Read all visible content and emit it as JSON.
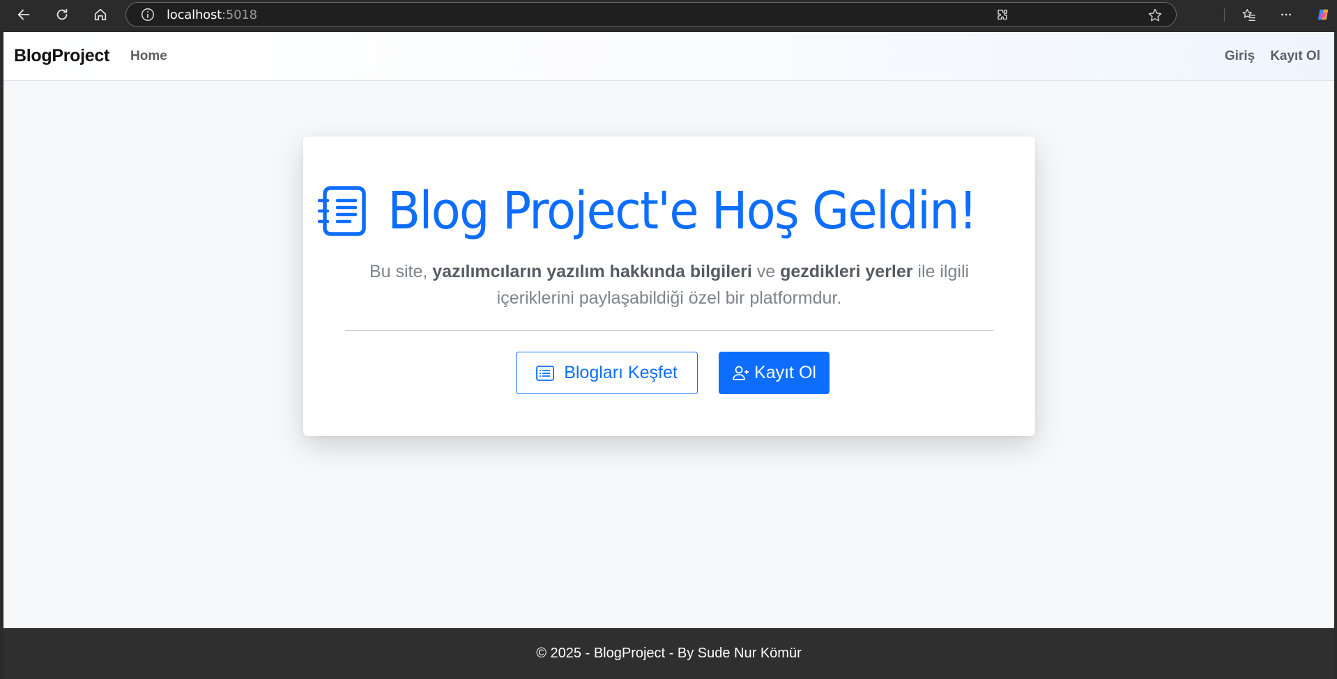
{
  "browser": {
    "url_host": "localhost",
    "url_port": ":5018"
  },
  "navbar": {
    "brand": "BlogProject",
    "home": "Home",
    "login": "Giriş",
    "register": "Kayıt Ol"
  },
  "hero": {
    "title": "Blog Project'e Hoş Geldin!",
    "lead_parts": [
      "Bu site, ",
      "yazılımcıların yazılım hakkında bilgileri",
      " ve ",
      "gezdikleri yerler",
      " ile ilgili içeriklerini paylaşabildiği özel bir platformdur."
    ],
    "explore_button": "Blogları Keşfet",
    "register_button": "Kayıt Ol"
  },
  "footer": {
    "text": "© 2025 - BlogProject - By Sude Nur Kömür"
  },
  "icons": {
    "hero": "journal-text-icon",
    "explore": "list-icon",
    "register": "person-plus-icon"
  },
  "colors": {
    "primary": "#0d6efd",
    "footer_bg": "#2f2f2f",
    "page_bg": "#f7f8fa"
  }
}
